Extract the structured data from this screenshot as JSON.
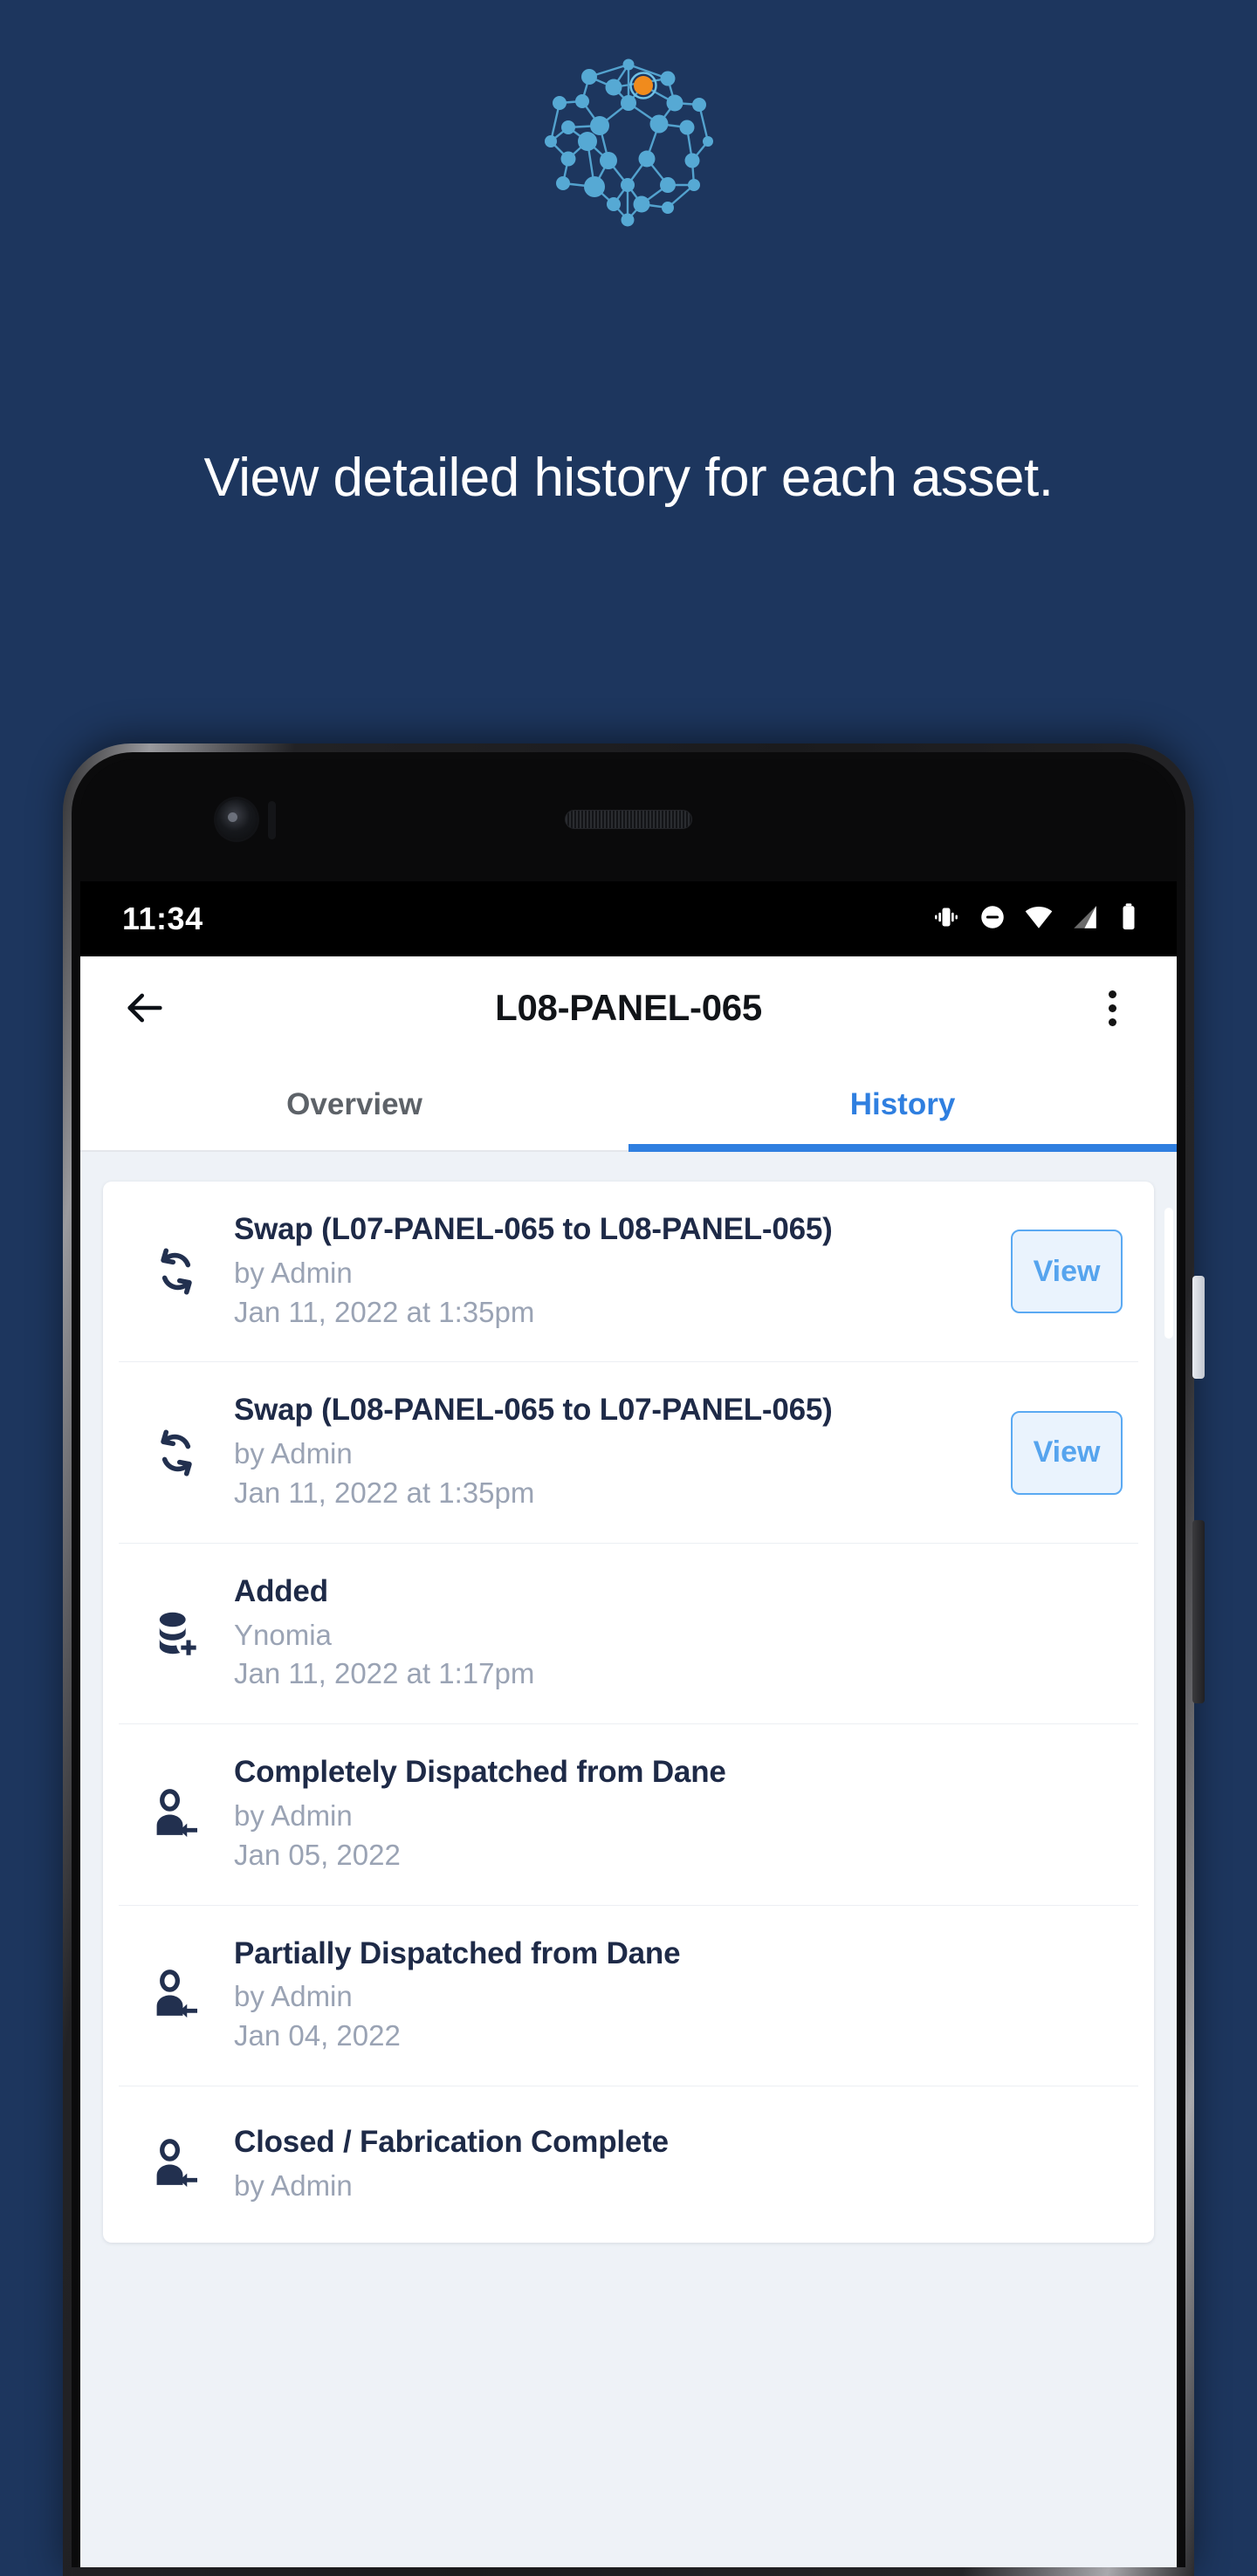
{
  "promo": {
    "headline": "View detailed history for each asset.",
    "logo_name": "ynomia-network-logo",
    "background_color": "#1d365e",
    "node_color": "#56a9d4",
    "accent_color": "#f08b1d"
  },
  "statusbar": {
    "time": "11:34",
    "icons": [
      "vibrate-icon",
      "do-not-disturb-icon",
      "wifi-icon",
      "cellular-signal-icon",
      "battery-icon"
    ]
  },
  "appbar": {
    "back_label": "←",
    "title": "L08-PANEL-065",
    "overflow_label": "More options"
  },
  "tabs": [
    {
      "label": "Overview",
      "active": false
    },
    {
      "label": "History",
      "active": true
    }
  ],
  "colors": {
    "tab_active": "#2f7fe0",
    "tab_inactive": "#5d6268",
    "title_text": "#1e2a47",
    "sub_text": "#9aa3b4",
    "view_border": "#5aa9f2",
    "view_fill": "#eaf3fd",
    "content_bg": "#eef2f7"
  },
  "history": [
    {
      "icon": "swap-icon",
      "title": "Swap (L07-PANEL-065 to L08-PANEL-065)",
      "subtitle": "by Admin",
      "date": "Jan 11, 2022 at 1:35pm",
      "action_label": "View"
    },
    {
      "icon": "swap-icon",
      "title": "Swap (L08-PANEL-065 to L07-PANEL-065)",
      "subtitle": "by Admin",
      "date": "Jan 11, 2022 at 1:35pm",
      "action_label": "View"
    },
    {
      "icon": "database-add-icon",
      "title": "Added",
      "subtitle": "Ynomia",
      "date": "Jan 11, 2022 at 1:17pm",
      "action_label": null
    },
    {
      "icon": "person-arrow-icon",
      "title": "Completely Dispatched from Dane",
      "subtitle": "by Admin",
      "date": "Jan 05, 2022",
      "action_label": null
    },
    {
      "icon": "person-arrow-icon",
      "title": "Partially Dispatched from Dane",
      "subtitle": "by Admin",
      "date": "Jan 04, 2022",
      "action_label": null
    },
    {
      "icon": "person-arrow-icon",
      "title": "Closed / Fabrication Complete",
      "subtitle": "by Admin",
      "date": "",
      "action_label": null
    }
  ]
}
